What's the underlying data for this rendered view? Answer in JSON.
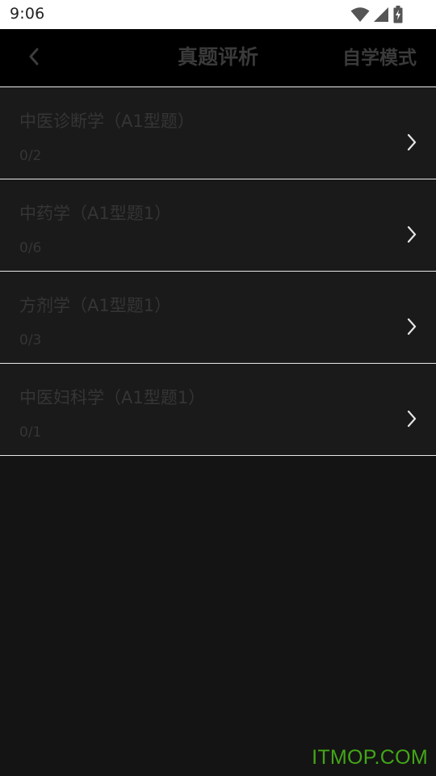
{
  "status_bar": {
    "time": "9:06",
    "icons": [
      "wifi-icon",
      "signal-icon",
      "battery-charging-icon"
    ]
  },
  "header": {
    "title": "真题评析",
    "mode_label": "自学模式",
    "back_icon": "chevron-left-icon"
  },
  "items": [
    {
      "title": "中医诊断学（A1型题）",
      "progress": "0/2"
    },
    {
      "title": "中药学（A1型题1）",
      "progress": "0/6"
    },
    {
      "title": "方剂学（A1型题1）",
      "progress": "0/3"
    },
    {
      "title": "中医妇科学（A1型题1）",
      "progress": "0/1"
    }
  ],
  "watermark": "ITMOP.COM",
  "colors": {
    "background": "#141414",
    "app_bar": "#000000",
    "status_bar": "#ffffff",
    "divider": "#e8e8e8",
    "dim_text": "#353535",
    "watermark": "#43a617"
  }
}
